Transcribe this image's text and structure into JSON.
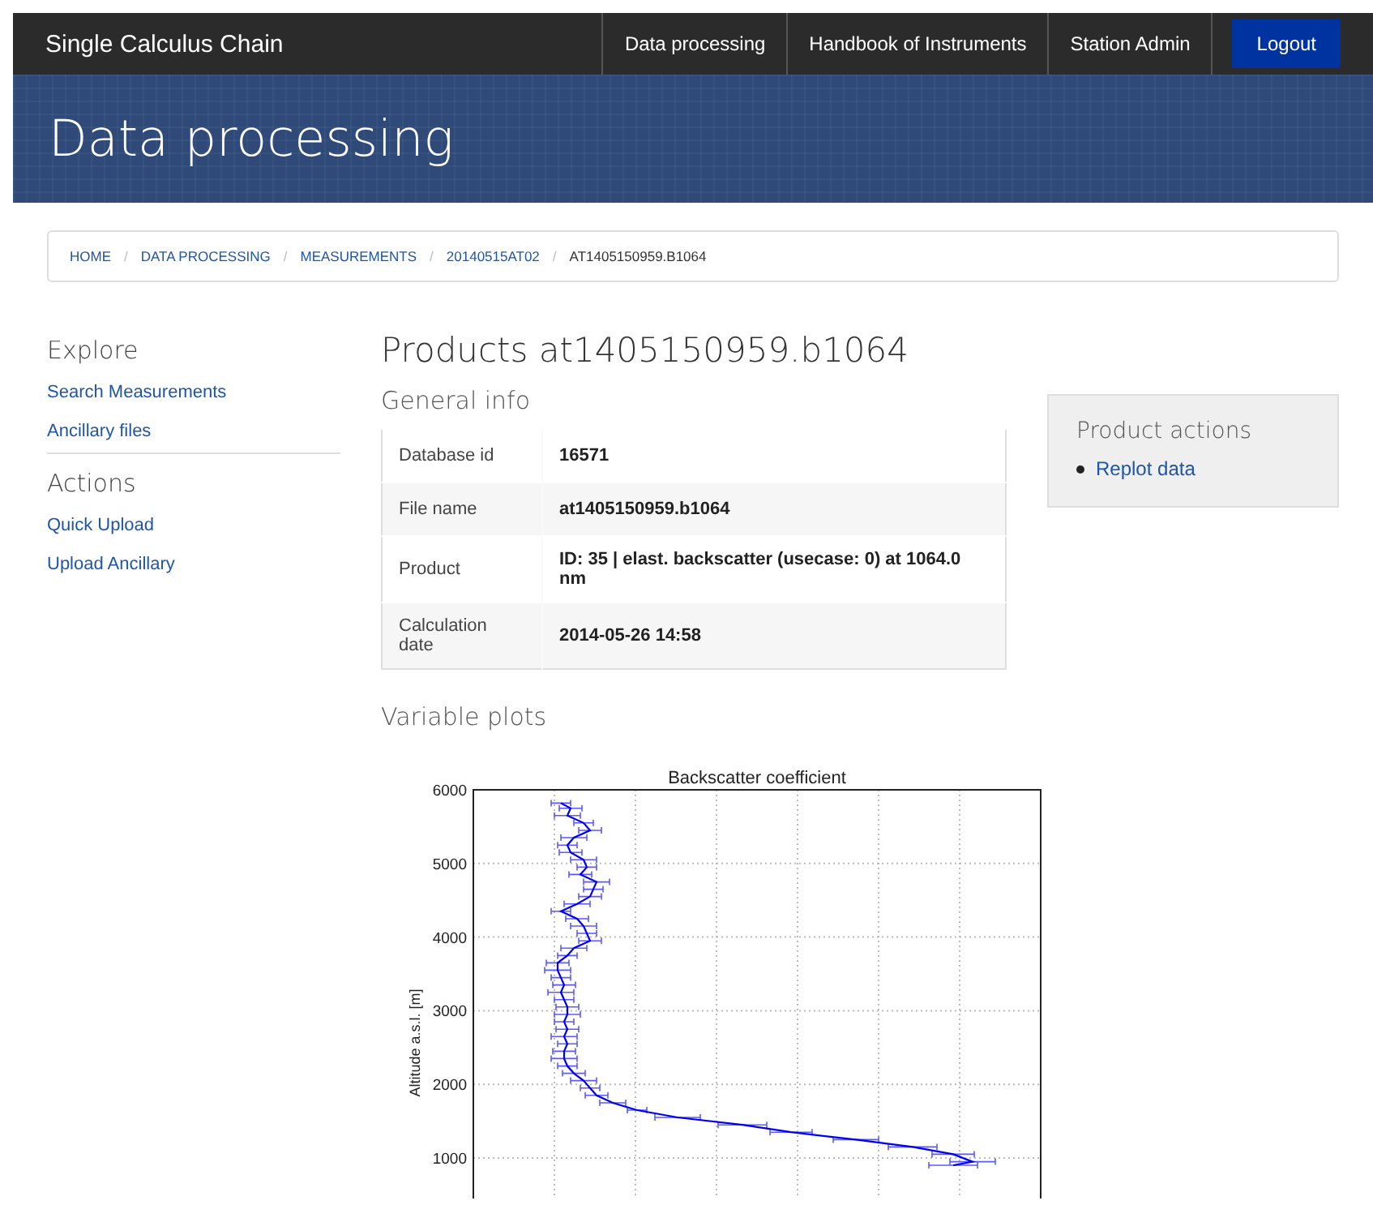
{
  "navbar": {
    "brand": "Single Calculus Chain",
    "links": [
      {
        "label": "Data processing",
        "kind": "link"
      },
      {
        "label": "Handbook of Instruments",
        "kind": "link"
      },
      {
        "label": "Station Admin",
        "kind": "link"
      },
      {
        "label": "Logout",
        "kind": "button"
      }
    ]
  },
  "banner": {
    "title": "Data processing"
  },
  "breadcrumb": [
    {
      "label": "HOME",
      "current": false
    },
    {
      "separator": "/",
      "label": "DATA PROCESSING",
      "current": false
    },
    {
      "separator": "/",
      "label": "MEASUREMENTS",
      "current": false
    },
    {
      "separator": "/",
      "label": "20140515AT02",
      "current": false
    },
    {
      "separator": "/",
      "label": "AT1405150959.B1064",
      "current": true
    }
  ],
  "sidebar": {
    "sections": [
      {
        "title": "Explore",
        "links": [
          "Search Measurements",
          "Ancillary files"
        ]
      },
      {
        "title": "Actions",
        "links": [
          "Quick Upload",
          "Upload Ancillary"
        ]
      }
    ]
  },
  "main": {
    "title": "Products at1405150959.b1064",
    "general_info": {
      "heading": "General info",
      "rows": [
        {
          "label": "Database id",
          "value": "16571"
        },
        {
          "label": "File name",
          "value": "at1405150959.b1064"
        },
        {
          "label": "Product",
          "value": "ID: 35 | elast. backscatter (usecase: 0) at 1064.0 nm"
        },
        {
          "label": "Calculation date",
          "value": "2014-05-26 14:58"
        }
      ]
    },
    "variable_plots": {
      "heading": "Variable plots",
      "plot": {
        "title": "Backscatter coefficient",
        "ylabel": "Altitude a.s.l. [m]",
        "yticks": [
          "6000",
          "5000",
          "4000",
          "3000",
          "2000",
          "1000"
        ]
      }
    }
  },
  "product_actions": {
    "title": "Product actions",
    "links": [
      "Replot data"
    ]
  }
}
